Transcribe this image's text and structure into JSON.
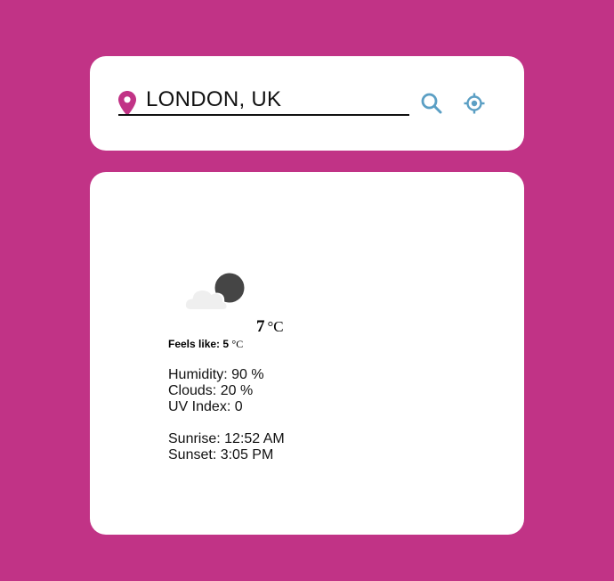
{
  "search": {
    "value": "LONDON, UK",
    "icons": {
      "location": "map-pin-icon",
      "search": "search-icon",
      "locate": "crosshair-icon"
    }
  },
  "weather": {
    "icon": "partly-cloudy-night-icon",
    "temperature": "7",
    "temperature_unit": "°C",
    "feels_like_label": "Feels like: 5",
    "feels_like_unit": "°C",
    "humidity": "Humidity: 90 %",
    "clouds": "Clouds: 20 %",
    "uv_index": "UV Index: 0",
    "sunrise": "Sunrise: 12:52 AM",
    "sunset": "Sunset: 3:05 PM"
  },
  "colors": {
    "background": "#c13386",
    "card": "#ffffff",
    "pin": "#c13386",
    "action_icons": "#5b9fc4"
  }
}
